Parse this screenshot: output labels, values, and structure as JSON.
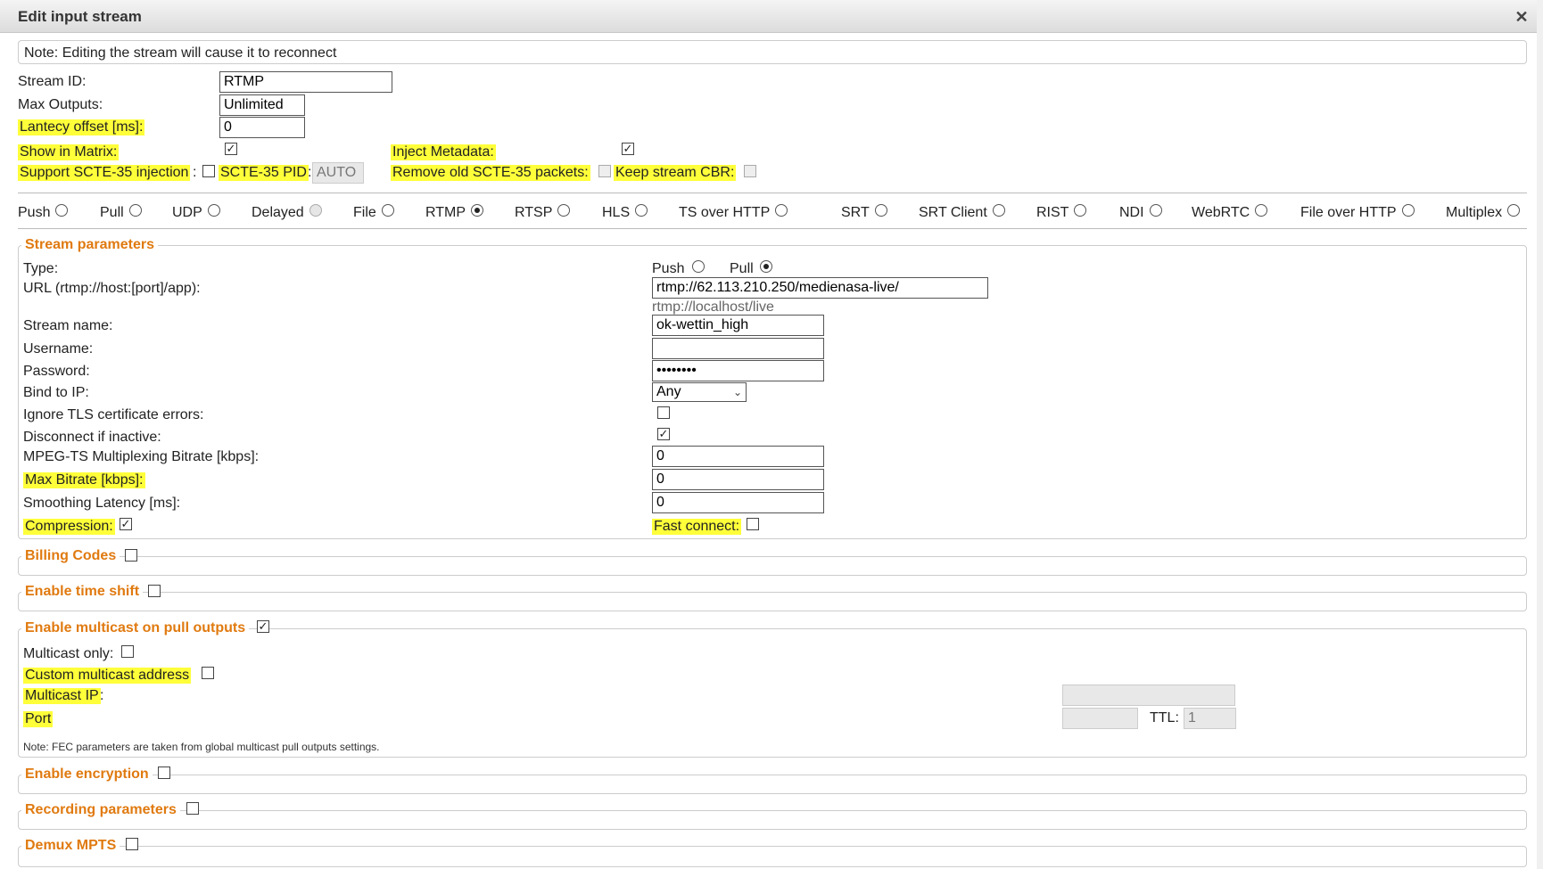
{
  "dialog": {
    "title": "Edit input stream",
    "close_icon": "close-icon"
  },
  "note": "Note: Editing the stream will cause it to reconnect",
  "top": {
    "stream_id_label": "Stream ID:",
    "stream_id_value": "RTMP",
    "max_outputs_label": "Max Outputs:",
    "max_outputs_value": "Unlimited",
    "latency_label": "Lantecy offset [ms]:",
    "latency_value": "0",
    "show_matrix_label": "Show in Matrix:",
    "show_matrix_checked": true,
    "inject_metadata_label": "Inject Metadata:",
    "inject_metadata_checked": true,
    "scte_label": "Support SCTE-35 injection",
    "scte_colon": ":",
    "scte_pid_label": "SCTE-35 PID",
    "scte_pid_colon": ":",
    "scte_pid_value": "AUTO",
    "remove_scte_label": "Remove old SCTE-35 packets:",
    "keep_cbr_label": "Keep stream CBR:"
  },
  "protocols": [
    "Push",
    "Pull",
    "UDP",
    "Delayed",
    "File",
    "RTMP",
    "RTSP",
    "HLS",
    "TS over HTTP",
    "SRT",
    "SRT Client",
    "RIST",
    "NDI",
    "WebRTC",
    "File over HTTP",
    "Multiplex"
  ],
  "protocol_selected": "RTMP",
  "stream_params": {
    "legend": "Stream parameters",
    "type_label": "Type:",
    "type_push": "Push",
    "type_pull": "Pull",
    "url_label": "URL (rtmp://host:[port]/app):",
    "url_value": "rtmp://62.113.210.250/medienasa-live/",
    "url_hint": "rtmp://localhost/live",
    "stream_name_label": "Stream name:",
    "stream_name_value": "ok-wettin_high",
    "username_label": "Username:",
    "username_value": "",
    "password_label": "Password:",
    "password_value": "••••••••",
    "bind_label": "Bind to IP:",
    "bind_value": "Any",
    "ignore_tls_label": "Ignore TLS certificate errors:",
    "disconnect_label": "Disconnect if inactive:",
    "mux_bitrate_label": "MPEG-TS Multiplexing Bitrate [kbps]:",
    "mux_bitrate_value": "0",
    "max_bitrate_label": "Max Bitrate [kbps]:",
    "max_bitrate_value": "0",
    "smoothing_label": "Smoothing Latency [ms]:",
    "smoothing_value": "0",
    "compression_label": "Compression:",
    "fast_connect_label": "Fast connect:"
  },
  "sections": {
    "billing": "Billing Codes",
    "timeshift": "Enable time shift",
    "multicast": "Enable multicast on pull outputs",
    "encryption": "Enable encryption",
    "recording": "Recording parameters",
    "demux": "Demux MPTS"
  },
  "multicast": {
    "only_label": "Multicast only:",
    "custom_label": "Custom multicast address",
    "ip_label": "Multicast IP",
    "ip_colon": ":",
    "port_label": "Port",
    "port_colon": ":",
    "ttl_label": "TTL:",
    "ttl_value": "1",
    "note": "Note: FEC parameters are taken from global multicast pull outputs settings."
  },
  "colors": {
    "accent": "#e07a10",
    "highlight": "#ffff3a"
  }
}
